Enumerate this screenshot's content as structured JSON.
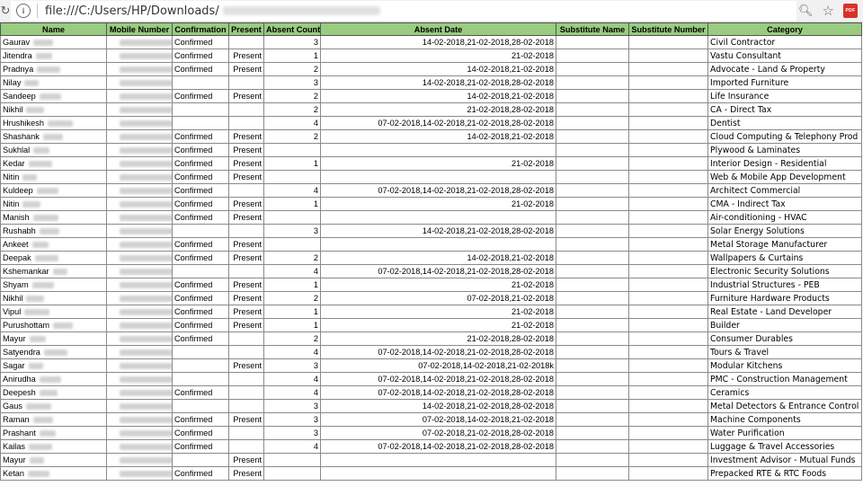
{
  "browser": {
    "url_prefix": "file:///C:/Users/HP/Downloads/",
    "ext_label": "PDF"
  },
  "columns": [
    "Name",
    "Mobile Number",
    "Confirmation",
    "Present",
    "Absent Count",
    "Absent Date",
    "Substitute Name",
    "Substitute Number",
    "Category"
  ],
  "rows": [
    {
      "name": "Gaurav",
      "confirmation": "Confirmed",
      "present": "",
      "absent_count": "3",
      "absent_date": "14-02-2018,21-02-2018,28-02-2018",
      "category": "Civil Contractor"
    },
    {
      "name": "Jitendra",
      "confirmation": "Confirmed",
      "present": "Present",
      "absent_count": "1",
      "absent_date": "21-02-2018",
      "category": "Vastu Consultant"
    },
    {
      "name": "Pradnya",
      "confirmation": "Confirmed",
      "present": "Present",
      "absent_count": "2",
      "absent_date": "14-02-2018,21-02-2018",
      "category": "Advocate - Land & Property"
    },
    {
      "name": "Nilay",
      "confirmation": "",
      "present": "",
      "absent_count": "3",
      "absent_date": "14-02-2018,21-02-2018,28-02-2018",
      "category": "Imported Furniture"
    },
    {
      "name": "Sandeep",
      "confirmation": "Confirmed",
      "present": "Present",
      "absent_count": "2",
      "absent_date": "14-02-2018,21-02-2018",
      "category": "Life Insurance"
    },
    {
      "name": "Nikhil",
      "confirmation": "",
      "present": "",
      "absent_count": "2",
      "absent_date": "21-02-2018,28-02-2018",
      "category": "CA - Direct Tax"
    },
    {
      "name": "Hrushikesh",
      "confirmation": "",
      "present": "",
      "absent_count": "4",
      "absent_date": "07-02-2018,14-02-2018,21-02-2018,28-02-2018",
      "category": "Dentist"
    },
    {
      "name": "Shashank",
      "confirmation": "Confirmed",
      "present": "Present",
      "absent_count": "2",
      "absent_date": "14-02-2018,21-02-2018",
      "category": "Cloud Computing & Telephony Prod"
    },
    {
      "name": "Sukhlal",
      "confirmation": "Confirmed",
      "present": "Present",
      "absent_count": "",
      "absent_date": "",
      "category": "Plywood & Laminates"
    },
    {
      "name": "Kedar",
      "confirmation": "Confirmed",
      "present": "Present",
      "absent_count": "1",
      "absent_date": "21-02-2018",
      "category": "Interior Design - Residential"
    },
    {
      "name": "Nitin",
      "confirmation": "Confirmed",
      "present": "Present",
      "absent_count": "",
      "absent_date": "",
      "category": "Web & Mobile App Development"
    },
    {
      "name": "Kuldeep",
      "confirmation": "Confirmed",
      "present": "",
      "absent_count": "4",
      "absent_date": "07-02-2018,14-02-2018,21-02-2018,28-02-2018",
      "category": "Architect Commercial"
    },
    {
      "name": "Nitin",
      "confirmation": "Confirmed",
      "present": "Present",
      "absent_count": "1",
      "absent_date": "21-02-2018",
      "category": "CMA - Indirect Tax"
    },
    {
      "name": "Manish",
      "confirmation": "Confirmed",
      "present": "Present",
      "absent_count": "",
      "absent_date": "",
      "category": "Air-conditioning - HVAC"
    },
    {
      "name": "Rushabh",
      "confirmation": "",
      "present": "",
      "absent_count": "3",
      "absent_date": "14-02-2018,21-02-2018,28-02-2018",
      "category": "Solar Energy Solutions"
    },
    {
      "name": "Ankeet",
      "confirmation": "Confirmed",
      "present": "Present",
      "absent_count": "",
      "absent_date": "",
      "category": "Metal Storage Manufacturer"
    },
    {
      "name": "Deepak",
      "confirmation": "Confirmed",
      "present": "Present",
      "absent_count": "2",
      "absent_date": "14-02-2018,21-02-2018",
      "category": "Wallpapers & Curtains"
    },
    {
      "name": "Kshemankar",
      "confirmation": "",
      "present": "",
      "absent_count": "4",
      "absent_date": "07-02-2018,14-02-2018,21-02-2018,28-02-2018",
      "category": "Electronic Security Solutions"
    },
    {
      "name": "Shyam",
      "confirmation": "Confirmed",
      "present": "Present",
      "absent_count": "1",
      "absent_date": "21-02-2018",
      "category": "Industrial Structures - PEB"
    },
    {
      "name": "Nikhil",
      "confirmation": "Confirmed",
      "present": "Present",
      "absent_count": "2",
      "absent_date": "07-02-2018,21-02-2018",
      "category": "Furniture Hardware Products"
    },
    {
      "name": "Vipul",
      "confirmation": "Confirmed",
      "present": "Present",
      "absent_count": "1",
      "absent_date": "21-02-2018",
      "category": "Real Estate - Land Developer"
    },
    {
      "name": "Purushottam",
      "confirmation": "Confirmed",
      "present": "Present",
      "absent_count": "1",
      "absent_date": "21-02-2018",
      "category": "Builder"
    },
    {
      "name": "Mayur",
      "confirmation": "Confirmed",
      "present": "",
      "absent_count": "2",
      "absent_date": "21-02-2018,28-02-2018",
      "category": "Consumer Durables"
    },
    {
      "name": "Satyendra",
      "confirmation": "",
      "present": "",
      "absent_count": "4",
      "absent_date": "07-02-2018,14-02-2018,21-02-2018,28-02-2018",
      "category": "Tours & Travel"
    },
    {
      "name": "Sagar",
      "confirmation": "",
      "present": "Present",
      "absent_count": "3",
      "absent_date": "07-02-2018,14-02-2018,21-02-2018k",
      "category": "Modular Kitchens"
    },
    {
      "name": "Anirudha",
      "confirmation": "",
      "present": "",
      "absent_count": "4",
      "absent_date": "07-02-2018,14-02-2018,21-02-2018,28-02-2018",
      "category": "PMC - Construction Management"
    },
    {
      "name": "Deepesh",
      "confirmation": "Confirmed",
      "present": "",
      "absent_count": "4",
      "absent_date": "07-02-2018,14-02-2018,21-02-2018,28-02-2018",
      "category": "Ceramics"
    },
    {
      "name": "Gaus",
      "confirmation": "",
      "present": "",
      "absent_count": "3",
      "absent_date": "14-02-2018,21-02-2018,28-02-2018",
      "category": "Metal Detectors & Entrance Control"
    },
    {
      "name": "Raman",
      "confirmation": "Confirmed",
      "present": "Present",
      "absent_count": "3",
      "absent_date": "07-02-2018,14-02-2018,21-02-2018",
      "category": "Machine Components"
    },
    {
      "name": "Prashant",
      "confirmation": "Confirmed",
      "present": "",
      "absent_count": "3",
      "absent_date": "07-02-2018,21-02-2018,28-02-2018",
      "category": "Water Purification"
    },
    {
      "name": "Kailas",
      "confirmation": "Confirmed",
      "present": "",
      "absent_count": "4",
      "absent_date": "07-02-2018,14-02-2018,21-02-2018,28-02-2018",
      "category": "Luggage & Travel Accessories"
    },
    {
      "name": "Mayur",
      "confirmation": "",
      "present": "Present",
      "absent_count": "",
      "absent_date": "",
      "category": "Investment Advisor - Mutual Funds"
    },
    {
      "name": "Ketan",
      "confirmation": "Confirmed",
      "present": "Present",
      "absent_count": "",
      "absent_date": "",
      "category": "Prepacked RTE & RTC Foods"
    }
  ]
}
